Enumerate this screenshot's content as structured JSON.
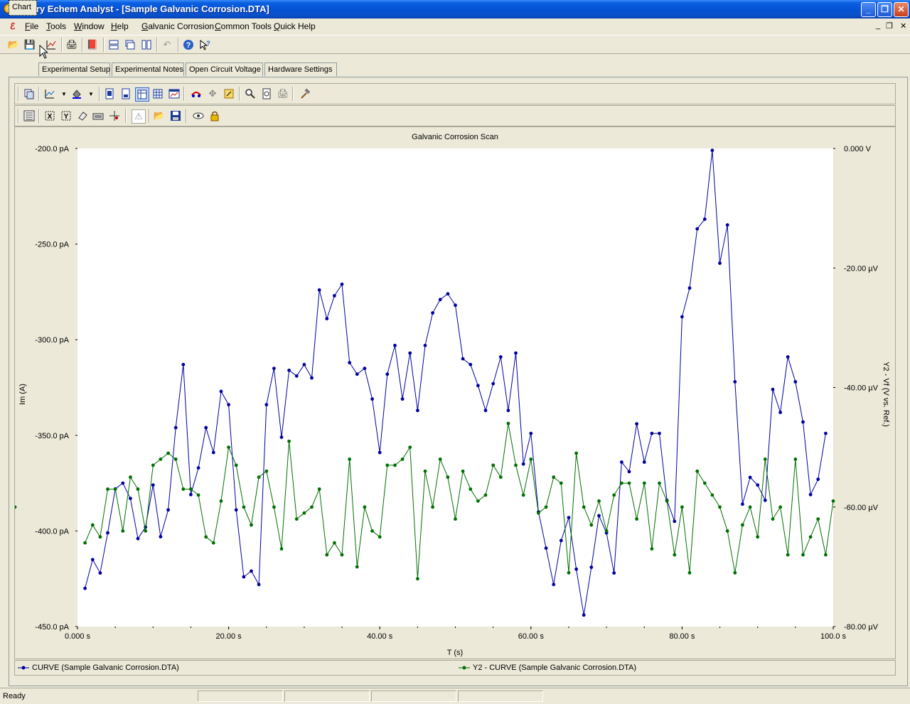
{
  "window": {
    "title": "Gamry Echem Analyst - [Sample Galvanic Corrosion.DTA]"
  },
  "menu": [
    {
      "label": "File",
      "ul": "F",
      "rest": "ile"
    },
    {
      "label": "Tools",
      "ul": "T",
      "rest": "ools"
    },
    {
      "label": "Window",
      "ul": "W",
      "rest": "indow"
    },
    {
      "label": "Help",
      "ul": "H",
      "rest": "elp"
    },
    {
      "label": "Galvanic Corrosion",
      "ul": "G",
      "rest": "alvanic Corrosion"
    },
    {
      "label": "Common Tools",
      "ul": "C",
      "rest": "ommon Tools"
    },
    {
      "label": "Quick Help",
      "ul": "Q",
      "rest": "uick Help"
    }
  ],
  "tabs": [
    "Chart",
    "Experimental Setup",
    "Experimental Notes",
    "Open Circuit Voltage",
    "Hardware Settings"
  ],
  "status": {
    "text": "Ready"
  },
  "colors": {
    "curve": "#0000a0",
    "y2": "#007000"
  },
  "legend": {
    "curve": "CURVE (Sample Galvanic Corrosion.DTA)",
    "y2": "Y2 - CURVE (Sample Galvanic Corrosion.DTA)"
  },
  "chart_data": {
    "type": "line",
    "title": "Galvanic Corrosion Scan",
    "xlabel": "T (s)",
    "ylabel": "Im (A)",
    "y2label": "Y2 - Vf (V vs. Ref.)",
    "xlim": [
      0,
      100
    ],
    "ylim": [
      -450,
      -200
    ],
    "y2lim": [
      -80,
      0
    ],
    "x_ticks": [
      "0.000 s",
      "20.00 s",
      "40.00 s",
      "60.00 s",
      "80.00 s",
      "100.0 s"
    ],
    "y_ticks": [
      "-200.0 pA",
      "-250.0 pA",
      "-300.0 pA",
      "-350.0 pA",
      "-400.0 pA",
      "-450.0 pA"
    ],
    "y2_ticks": [
      "0.000 V",
      "-20.00 µV",
      "-40.00 µV",
      "-60.00 µV",
      "-80.00 µV"
    ],
    "grid": false,
    "x": [
      1,
      2,
      3,
      4,
      5,
      6,
      7,
      8,
      9,
      10,
      11,
      12,
      13,
      14,
      15,
      16,
      17,
      18,
      19,
      20,
      21,
      22,
      23,
      24,
      25,
      26,
      27,
      28,
      29,
      30,
      31,
      32,
      33,
      34,
      35,
      36,
      37,
      38,
      39,
      40,
      41,
      42,
      43,
      44,
      45,
      46,
      47,
      48,
      49,
      50,
      51,
      52,
      53,
      54,
      55,
      56,
      57,
      58,
      59,
      60,
      61,
      62,
      63,
      64,
      65,
      66,
      67,
      68,
      69,
      70,
      71,
      72,
      73,
      74,
      75,
      76,
      77,
      78,
      79,
      80,
      81,
      82,
      83,
      84,
      85,
      86,
      87,
      88,
      89,
      90,
      91,
      92,
      93,
      94,
      95,
      96,
      97,
      98,
      99,
      100
    ],
    "series": [
      {
        "name": "CURVE (Sample Galvanic Corrosion.DTA)",
        "axis": "left",
        "values": [
          -430,
          -415,
          -422,
          -401,
          -378,
          -375,
          -383,
          -404,
          -398,
          -376,
          -403,
          -389,
          -346,
          -313,
          -381,
          -367,
          -346,
          -359,
          -327,
          -334,
          -389,
          -424,
          -421,
          -428,
          -334,
          -315,
          -351,
          -316,
          -319,
          -313,
          -320,
          -274,
          -289,
          -277,
          -271,
          -312,
          -318,
          -315,
          -331,
          -359,
          -318,
          -303,
          -331,
          -307,
          -337,
          -303,
          -286,
          -279,
          -276,
          -282,
          -310,
          -313,
          -324,
          -337,
          -323,
          -309,
          -337,
          -307,
          -365,
          -349,
          -390,
          -409,
          -428,
          -405,
          -393,
          -420,
          -444,
          -419,
          -392,
          -401,
          -422,
          -364,
          -369,
          -344,
          -364,
          -349,
          -349,
          -384,
          -395,
          -288,
          -273,
          -242,
          -237,
          -201,
          -260,
          -240,
          -322,
          -386,
          -372,
          -376,
          -384,
          -326,
          -338,
          -309,
          -322,
          -343,
          -381,
          -373,
          -349
        ]
      },
      {
        "name": "Y2 - CURVE (Sample Galvanic Corrosion.DTA)",
        "axis": "right",
        "values": [
          -66,
          -63,
          -65,
          -57,
          -57,
          -64,
          -55,
          -57,
          -64,
          -53,
          -52,
          -51,
          -52,
          -57,
          -57,
          -58,
          -65,
          -66,
          -59,
          -50,
          -53,
          -60,
          -63,
          -55,
          -54,
          -60,
          -67,
          -49,
          -62,
          -61,
          -60,
          -57,
          -68,
          -66,
          -68,
          -52,
          -70,
          -60,
          -64,
          -65,
          -53,
          -53,
          -52,
          -50,
          -72,
          -54,
          -60,
          -52,
          -55,
          -62,
          -54,
          -57,
          -59,
          -58,
          -53,
          -55,
          -46,
          -53,
          -58,
          -52,
          -61,
          -60,
          -55,
          -56,
          -71,
          -51,
          -60,
          -63,
          -59,
          -64,
          -58,
          -56,
          -56,
          -62,
          -56,
          -67,
          -56,
          -59,
          -68,
          -60,
          -71,
          -54,
          -56,
          -58,
          -60,
          -64,
          -71,
          -63,
          -60,
          -65,
          -52,
          -62,
          -60,
          -68,
          -52,
          -68,
          -65,
          -62,
          -68,
          -59,
          -60
        ]
      }
    ]
  }
}
